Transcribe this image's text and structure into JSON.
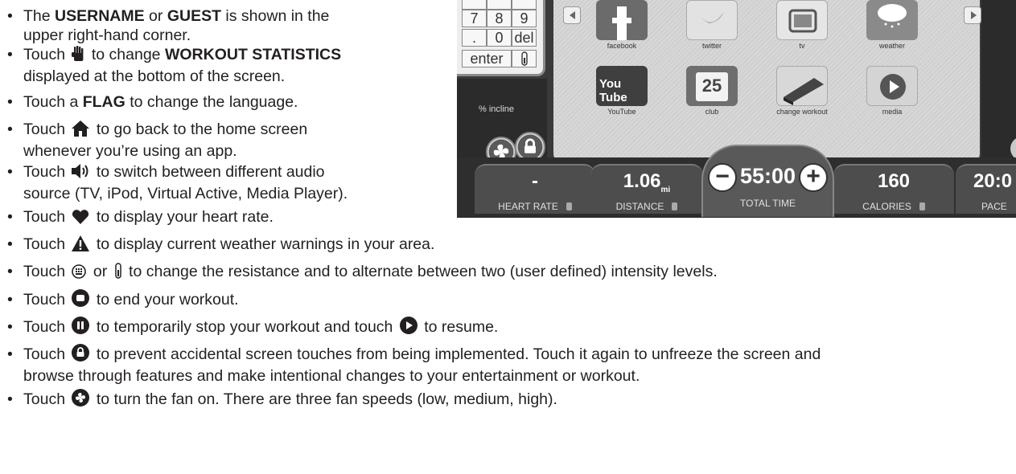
{
  "bullets": [
    {
      "pre": "The ",
      "b1": "USERNAME",
      "mid": " or ",
      "b2": "GUEST",
      "post": " is shown in the",
      "line2": "upper right-hand corner."
    },
    {
      "pre": "Touch ",
      "icon": "hand-icon",
      "post": " to change ",
      "b1": "WORKOUT STATISTICS",
      "line2": "displayed at the bottom of the screen."
    },
    {
      "pre": "Touch a ",
      "b1": "FLAG",
      "post": " to change the language."
    },
    {
      "pre": "Touch ",
      "icon": "home-icon",
      "post": " to go back to the home screen",
      "line2": "whenever you’re using an app."
    },
    {
      "pre": "Touch ",
      "icon": "speaker-icon",
      "post": " to switch between different audio",
      "line2": "source (TV, iPod, Virtual Active, Media Player)."
    },
    {
      "pre": "Touch ",
      "icon": "heart-icon",
      "post": " to display your heart rate."
    },
    {
      "pre": "Touch ",
      "icon": "warning-icon",
      "post": " to display current weather warnings in your area."
    },
    {
      "pre": "Touch ",
      "icon": "keypad-icon",
      "mid": " or ",
      "icon2": "thermometer-icon",
      "post": " to change the resistance and to alternate between two (user defined) intensity levels."
    },
    {
      "pre": "Touch ",
      "icon": "stop-icon",
      "post": " to end your workout."
    },
    {
      "pre": "Touch ",
      "icon": "pause-icon",
      "mid": " to temporarily stop your workout and touch ",
      "icon2": "play-icon",
      "post": " to resume."
    },
    {
      "pre": "Touch ",
      "icon": "lock-icon",
      "post": " to prevent accidental screen touches from being implemented. Touch it again to unfreeze the screen and",
      "line2": "browse through features and make intentional changes to your entertainment or workout."
    },
    {
      "pre": "Touch ",
      "icon": "fan-icon",
      "post": " to turn the fan on. There are three fan speeds (low, medium, high)."
    }
  ],
  "screen": {
    "keypad": {
      "row1": [
        "7",
        "8",
        "9"
      ],
      "row2": [
        ".",
        "0",
        "del"
      ],
      "enter": "enter"
    },
    "incline_label": "% incline",
    "apps": [
      {
        "label": "facebook",
        "icon": "facebook-icon"
      },
      {
        "label": "twitter",
        "icon": "twitter-icon"
      },
      {
        "label": "tv",
        "icon": "tv-icon"
      },
      {
        "label": "weather",
        "icon": "weather-icon"
      },
      {
        "label": "YouTube",
        "icon": "youtube-icon",
        "text": "You Tube"
      },
      {
        "label": "club",
        "icon": "calendar-icon",
        "text": "25"
      },
      {
        "label": "change workout",
        "icon": "change-workout-icon"
      },
      {
        "label": "media",
        "icon": "media-play-icon"
      }
    ],
    "stats": {
      "heart_rate": {
        "value": "-",
        "label": "HEART RATE"
      },
      "distance": {
        "value": "1.06",
        "unit": "mi",
        "label": "DISTANCE"
      },
      "total_time": {
        "value": "55:00",
        "label": "TOTAL TIME"
      },
      "calories": {
        "value": "160",
        "label": "CALORIES"
      },
      "pace": {
        "value": "20:0",
        "label": "PACE"
      }
    }
  }
}
